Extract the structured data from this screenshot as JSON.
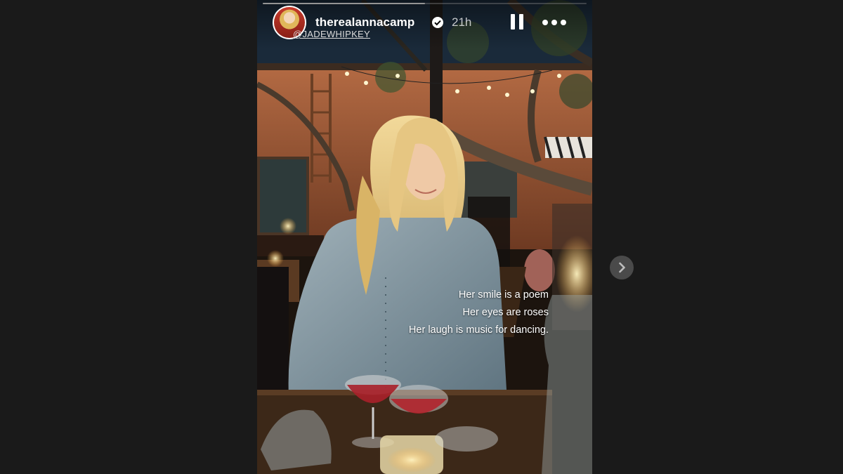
{
  "story": {
    "username": "therealannacamp",
    "verified_icon": "verified-badge-icon",
    "time_ago": "21h",
    "mention_tag": "@JADEWHIPKEY",
    "progress": 0.5,
    "caption_lines": [
      "Her smile is a poem",
      "Her eyes are roses",
      "Her laugh is music for dancing."
    ]
  },
  "controls": {
    "pause_icon": "pause-icon",
    "more_icon": "more-options-icon",
    "next_icon": "chevron-right-icon"
  },
  "colors": {
    "page_background": "#1a1a1a",
    "text": "#ffffff",
    "next_button": "#4a4a4a"
  }
}
